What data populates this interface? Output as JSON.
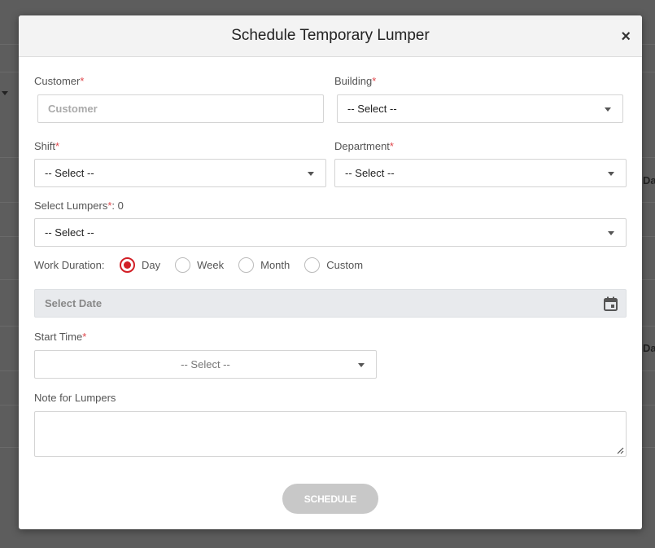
{
  "background": {
    "fragments": [
      "Dat",
      "Dat"
    ]
  },
  "modal": {
    "title": "Schedule Temporary Lumper",
    "close_label": "×"
  },
  "form": {
    "customer": {
      "label": "Customer",
      "required_mark": "*",
      "placeholder": "Customer"
    },
    "building": {
      "label": "Building",
      "required_mark": "*",
      "value": "-- Select --"
    },
    "shift": {
      "label": "Shift",
      "required_mark": "*",
      "value": "-- Select --"
    },
    "department": {
      "label": "Department",
      "required_mark": "*",
      "value": "-- Select --"
    },
    "lumpers": {
      "label": "Select Lumpers",
      "required_mark": "*",
      "count_text": ": 0",
      "value": "-- Select --"
    },
    "work_duration": {
      "label": "Work Duration:",
      "options": [
        {
          "label": "Day",
          "checked": true
        },
        {
          "label": "Week",
          "checked": false
        },
        {
          "label": "Month",
          "checked": false
        },
        {
          "label": "Custom",
          "checked": false
        }
      ]
    },
    "date": {
      "placeholder": "Select Date"
    },
    "start_time": {
      "label": "Start Time",
      "required_mark": "*",
      "value": "-- Select --"
    },
    "note": {
      "label": "Note for Lumpers",
      "value": ""
    },
    "schedule_button": "SCHEDULE"
  },
  "colors": {
    "accent": "#d21f26",
    "required": "#e0474c",
    "button_disabled": "#c8c8c8"
  }
}
